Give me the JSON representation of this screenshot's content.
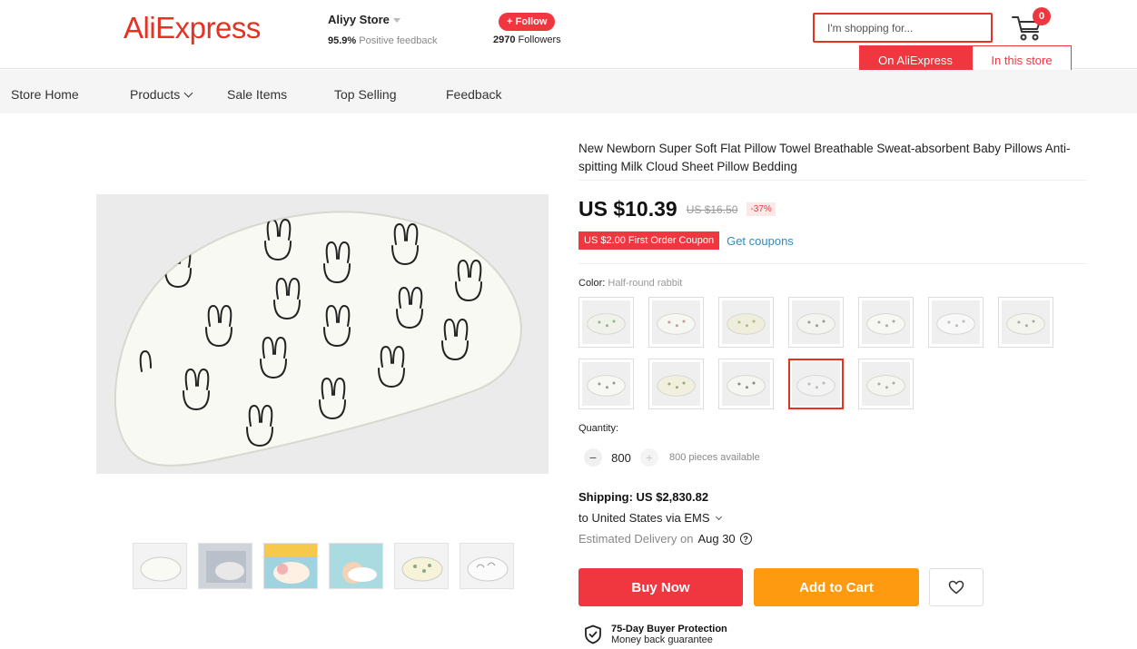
{
  "header": {
    "logo": "AliExpress",
    "store_name": "Aliyy Store",
    "feedback_percent": "95.9%",
    "feedback_label": "Positive feedback",
    "follow_label": "+ Follow",
    "followers_count": "2970",
    "followers_label": "Followers",
    "search_placeholder": "I'm shopping for...",
    "cart_count": "0",
    "scope_aliexpress": "On AliExpress",
    "scope_store": "In this store"
  },
  "nav": {
    "items": [
      "Store Home",
      "Products",
      "Sale Items",
      "Top Selling",
      "Feedback"
    ]
  },
  "product": {
    "title": "New Newborn Super Soft Flat Pillow Towel Breathable Sweat-absorbent Baby Pillows Anti-spitting Milk Cloud Sheet Pillow Bedding",
    "price": "US $10.39",
    "original_price": "US $16.50",
    "discount": "-37%",
    "coupon": "US $2.00 First Order Coupon",
    "get_coupons": "Get coupons",
    "color_label": "Color:",
    "color_value": "Half-round rabbit",
    "selected_swatch_index": 10,
    "quantity_label": "Quantity:",
    "quantity_minus": "−",
    "quantity_value": "800",
    "quantity_plus": "+",
    "available": "800 pieces available",
    "shipping": "Shipping: US $2,830.82",
    "ship_to": "to United States via EMS",
    "delivery_label": "Estimated Delivery on",
    "delivery_date": "Aug 30",
    "help_glyph": "?",
    "buy_now": "Buy Now",
    "add_to_cart": "Add to Cart",
    "protection_title": "75-Day Buyer Protection",
    "protection_sub": "Money back guarantee"
  },
  "colors": {
    "brand_red": "#e43225",
    "button_red": "#f0373f",
    "cart_orange": "#fd9a10",
    "link_blue": "#2f8bc0"
  }
}
